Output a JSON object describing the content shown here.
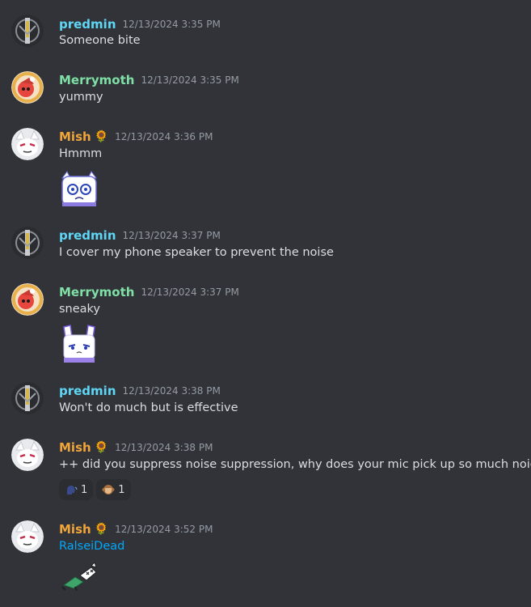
{
  "messages": [
    {
      "user": "predmin",
      "time": "12/13/2024 3:35 PM",
      "text": "Someone bite"
    },
    {
      "user": "Merrymoth",
      "time": "12/13/2024 3:35 PM",
      "text": "yummy"
    },
    {
      "user": "Mish",
      "badge": "🌻",
      "time": "12/13/2024 3:36 PM",
      "text": "Hmmm",
      "sticker": "ralsei-shocked-sticker"
    },
    {
      "user": "predmin",
      "time": "12/13/2024 3:37 PM",
      "text": "I cover my phone speaker to prevent the noise"
    },
    {
      "user": "Merrymoth",
      "time": "12/13/2024 3:37 PM",
      "text": "sneaky",
      "sticker": "bunny-sticker"
    },
    {
      "user": "predmin",
      "time": "12/13/2024 3:38 PM",
      "text": "Won't do much but is effective"
    },
    {
      "user": "Mish",
      "badge": "🌻",
      "time": "12/13/2024 3:38 PM",
      "text": "++ did you suppress noise suppression, why does your mic pick up so much noice",
      "reactions": [
        {
          "icon": "speaking-head-icon",
          "count": "1"
        },
        {
          "icon": "see-no-evil-monkey-icon",
          "count": "1"
        }
      ]
    },
    {
      "user": "Mish",
      "badge": "🌻",
      "time": "12/13/2024 3:52 PM",
      "text": "RalseiDead",
      "link": true,
      "sticker": "ralsei-dead-sticker"
    }
  ],
  "colors": {
    "predmin": "#5fd6f5",
    "Merrymoth": "#7fe0a6",
    "Mish": "#f0a53a",
    "link": "#00a8fc",
    "background": "#313338"
  }
}
